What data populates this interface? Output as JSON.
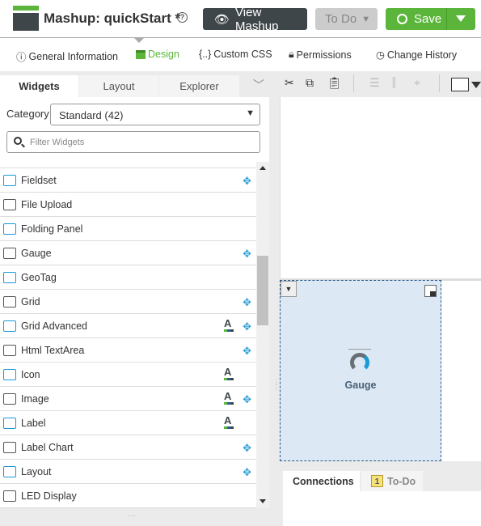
{
  "header": {
    "title": "Mashup: quickStart *",
    "help_icon": "question-circle-icon",
    "view_label": "View Mashup",
    "todo_label": "To Do",
    "save_label": "Save"
  },
  "nav": [
    {
      "label": "General Information",
      "icon": "info-icon"
    },
    {
      "label": "Design",
      "icon": "design-icon",
      "active": true
    },
    {
      "label": "Custom CSS",
      "icon": "css-icon"
    },
    {
      "label": "Permissions",
      "icon": "lock-icon"
    },
    {
      "label": "Change History",
      "icon": "clock-icon"
    }
  ],
  "left_tabs": [
    "Widgets",
    "Layout",
    "Explorer"
  ],
  "category": {
    "label": "Category",
    "value": "Standard (42)"
  },
  "filter": {
    "placeholder": "Filter Widgets"
  },
  "widgets": [
    {
      "label": "Fieldset",
      "move": true,
      "style": false
    },
    {
      "label": "File Upload",
      "move": false,
      "style": false
    },
    {
      "label": "Folding Panel",
      "move": false,
      "style": false
    },
    {
      "label": "Gauge",
      "move": true,
      "style": false
    },
    {
      "label": "GeoTag",
      "move": false,
      "style": false
    },
    {
      "label": "Grid",
      "move": true,
      "style": false
    },
    {
      "label": "Grid Advanced",
      "move": true,
      "style": true
    },
    {
      "label": "Html TextArea",
      "move": true,
      "style": false
    },
    {
      "label": "Icon",
      "move": false,
      "style": true
    },
    {
      "label": "Image",
      "move": true,
      "style": true
    },
    {
      "label": "Label",
      "move": false,
      "style": true
    },
    {
      "label": "Label Chart",
      "move": true,
      "style": false
    },
    {
      "label": "Layout",
      "move": true,
      "style": false
    },
    {
      "label": "LED Display",
      "move": false,
      "style": false
    }
  ],
  "canvas": {
    "widget_label": "Gauge"
  },
  "bottom_tabs": {
    "connections": "Connections",
    "todo": "To-Do",
    "todo_count": "1"
  },
  "colors": {
    "accent": "#5bb53a",
    "dark": "#3f4649",
    "selection": "#dce9f5"
  }
}
